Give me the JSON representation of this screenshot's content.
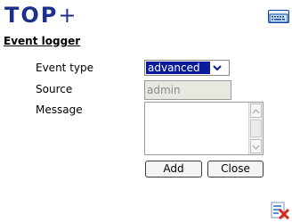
{
  "app": {
    "brand_main": "TOP",
    "brand_plus": "+"
  },
  "page": {
    "title": "Event logger"
  },
  "form": {
    "event_type_label": "Event type",
    "event_type_value": "advanced",
    "source_label": "Source",
    "source_value": "admin",
    "message_label": "Message",
    "message_value": ""
  },
  "buttons": {
    "add": "Add",
    "close": "Close"
  },
  "icons": {
    "keyboard": "keyboard-icon",
    "dropdown": "chevron-down-icon",
    "corner": "edit-close-icon"
  },
  "colors": {
    "brand": "#1c2f8c",
    "selection": "#0a1a9b",
    "disabled_bg": "#e8e8e0"
  }
}
